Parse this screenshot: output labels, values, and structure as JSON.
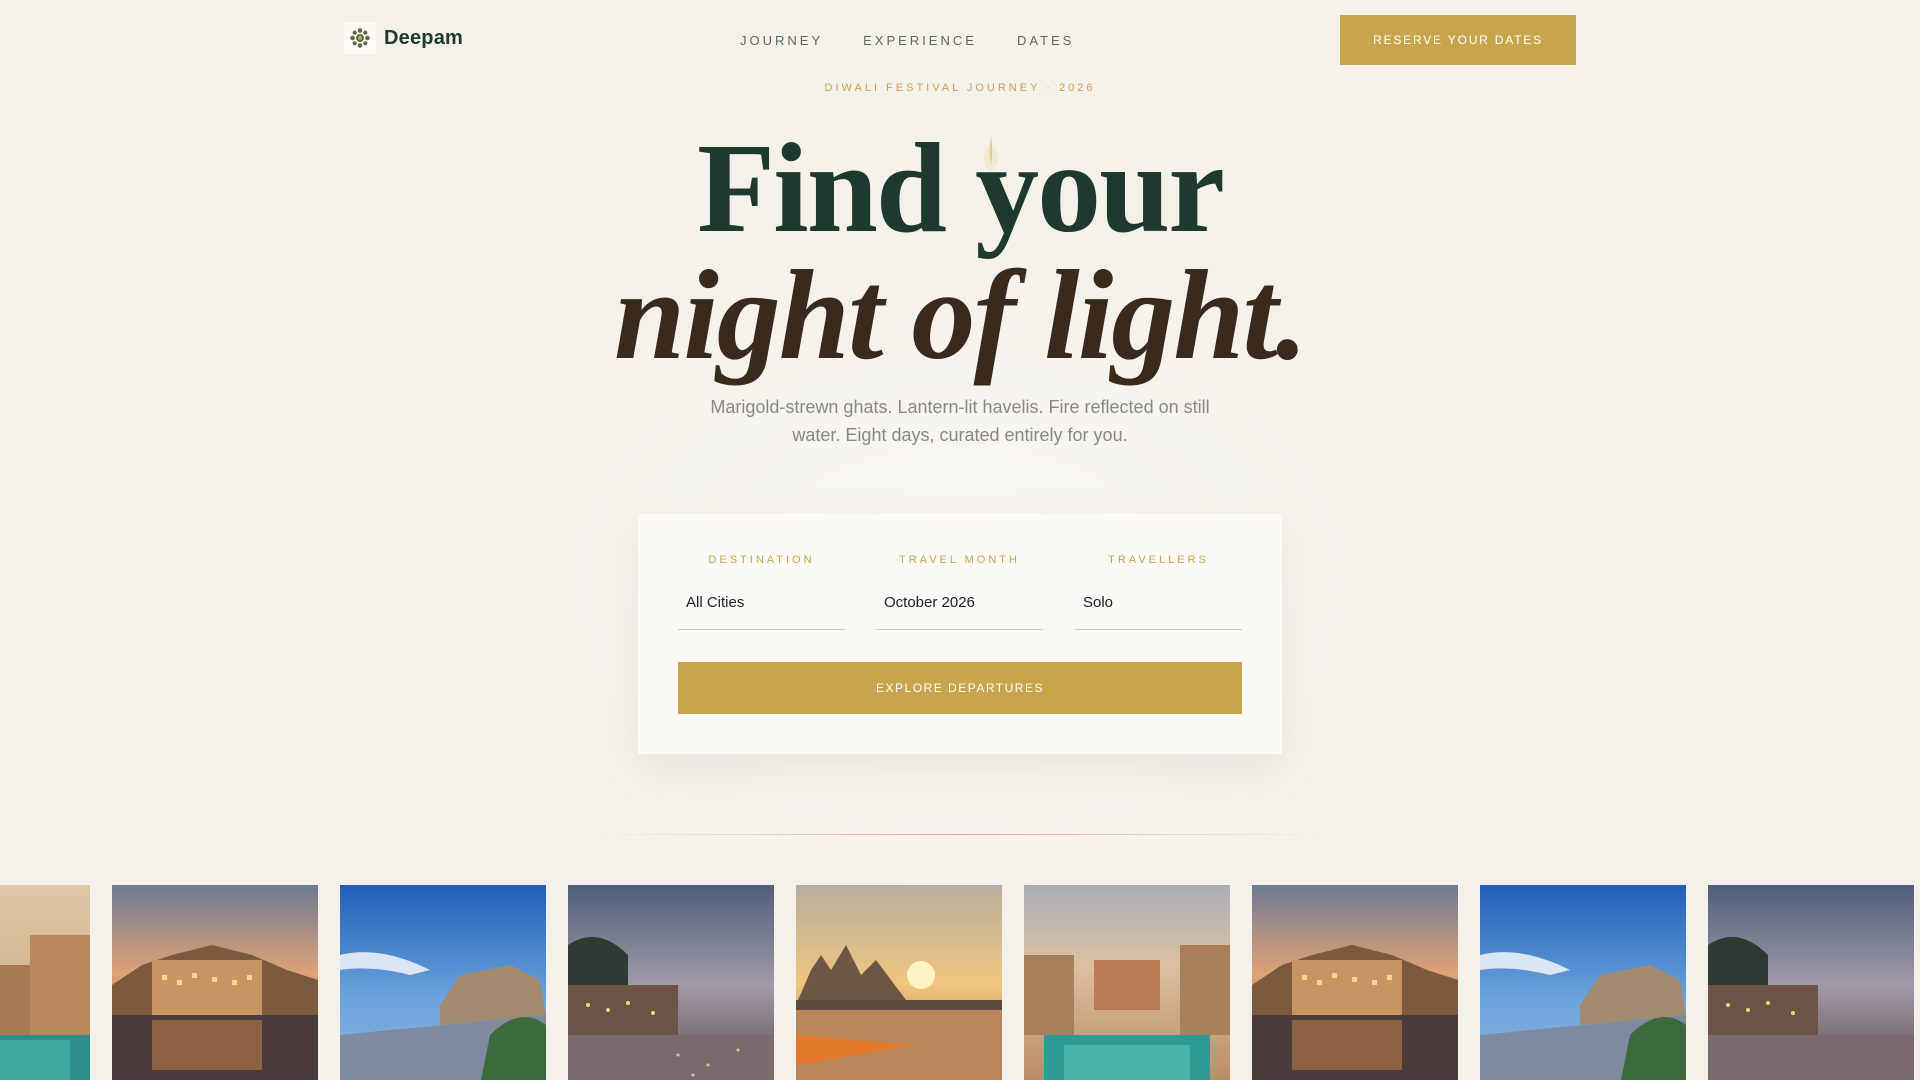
{
  "nav": {
    "brand": "Deepam",
    "links": [
      "JOURNEY",
      "EXPERIENCE",
      "DATES"
    ],
    "cta": "RESERVE YOUR DATES"
  },
  "hero": {
    "eyebrow": "DIWALI FESTIVAL JOURNEY · 2026",
    "title_line1": "Find your",
    "title_line2": "night of light.",
    "subtitle": "Marigold-strewn ghats. Lantern-lit havelis. Fire reflected on still water. Eight days, curated entirely for you."
  },
  "search": {
    "destination": {
      "label": "DESTINATION",
      "value": "All Cities"
    },
    "month": {
      "label": "TRAVEL MONTH",
      "value": "October 2026"
    },
    "travellers": {
      "label": "TRAVELLERS",
      "value": "Solo"
    },
    "submit": "EXPLORE DEPARTURES"
  },
  "gallery": {
    "photos": [
      "stepwell-pool",
      "lake-palace-dusk",
      "blue-city-fort",
      "ghats-dusk",
      "temple-sunset",
      "stepwell-pool",
      "lake-palace-dusk",
      "blue-city-fort",
      "ghats-dusk"
    ]
  },
  "colors": {
    "accent": "#c8a54c",
    "heading": "#1e3a2f",
    "heading_italic": "#3a2a1e",
    "background": "#f4f1ea"
  },
  "icons": {
    "brand": "mandala-icon",
    "title_ornament": "diya-flame-icon"
  }
}
